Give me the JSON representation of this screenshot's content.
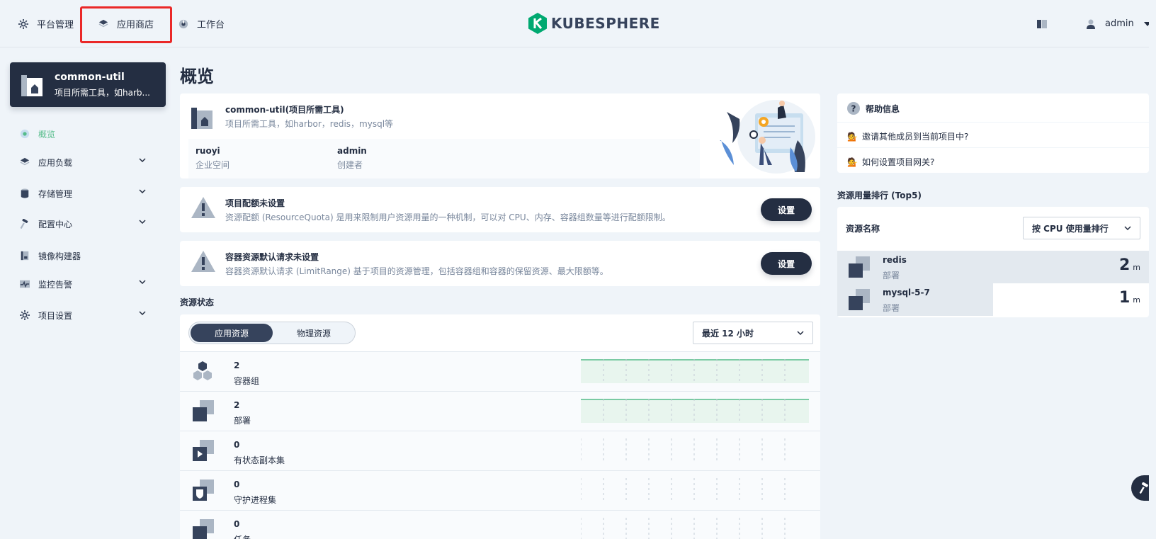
{
  "topbar": {
    "platform": "平台管理",
    "appstore": "应用商店",
    "workbench": "工作台",
    "logo": "KUBESPHERE",
    "user": "admin"
  },
  "project": {
    "name": "common-util",
    "desc": "项目所需工具，如harb..."
  },
  "sidebar": {
    "items": [
      {
        "label": "概览"
      },
      {
        "label": "应用负载"
      },
      {
        "label": "存储管理"
      },
      {
        "label": "配置中心"
      },
      {
        "label": "镜像构建器"
      },
      {
        "label": "监控告警"
      },
      {
        "label": "项目设置"
      }
    ]
  },
  "main": {
    "title": "概览",
    "info": {
      "name": "common-util(项目所需工具)",
      "desc": "项目所需工具，如harbor，redis，mysql等",
      "workspace_value": "ruoyi",
      "workspace_label": "企业空间",
      "creator_value": "admin",
      "creator_label": "创建者"
    },
    "quota": {
      "title": "项目配额未设置",
      "desc": "资源配额 (ResourceQuota) 是用来限制用户资源用量的一种机制，可以对 CPU、内存、容器组数量等进行配额限制。",
      "button": "设置"
    },
    "limit": {
      "title": "容器资源默认请求未设置",
      "desc": "容器资源默认请求 (LimitRange) 基于项目的资源管理，包括容器组和容器的保留资源、最大限额等。",
      "button": "设置"
    },
    "resource_status": {
      "label": "资源状态",
      "tab_app": "应用资源",
      "tab_physical": "物理资源",
      "range": "最近 12 小时",
      "rows": [
        {
          "count": "2",
          "name": "容器组"
        },
        {
          "count": "2",
          "name": "部署"
        },
        {
          "count": "0",
          "name": "有状态副本集"
        },
        {
          "count": "0",
          "name": "守护进程集"
        },
        {
          "count": "0",
          "name": "任务"
        }
      ]
    }
  },
  "help": {
    "title": "帮助信息",
    "link1": "邀请其他成员到当前项目中?",
    "link2": "如何设置项目网关?"
  },
  "ranking": {
    "label": "资源用量排行 (Top5)",
    "head": "资源名称",
    "sort": "按 CPU 使用量排行",
    "unit": "m",
    "rows": [
      {
        "name": "redis",
        "type": "部署",
        "value": "2",
        "share": 1.0
      },
      {
        "name": "mysql-5-7",
        "type": "部署",
        "value": "1",
        "share": 0.5
      }
    ]
  },
  "colors": {
    "primary": "#242e42",
    "accent": "#55bc8a",
    "highlight": "#ea2828"
  }
}
